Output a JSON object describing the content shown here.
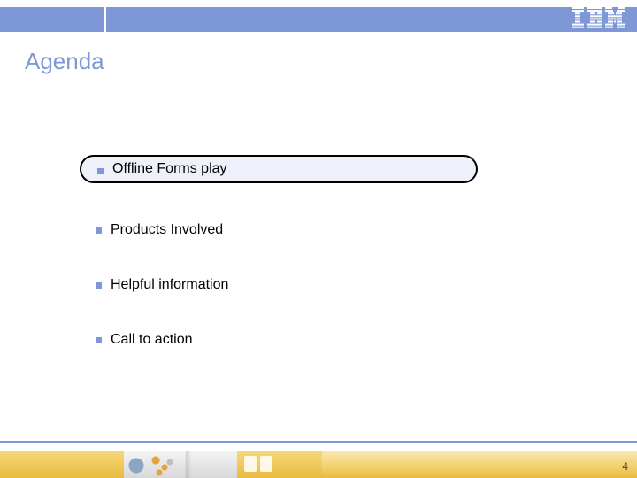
{
  "header": {
    "logo_alt": "IBM"
  },
  "title": "Agenda",
  "agenda": {
    "highlighted_index": 0,
    "items": [
      {
        "label": "Offline Forms play"
      },
      {
        "label": "Products Involved"
      },
      {
        "label": "Helpful information"
      },
      {
        "label": "Call to action"
      }
    ]
  },
  "footer": {
    "page_number": "4"
  }
}
